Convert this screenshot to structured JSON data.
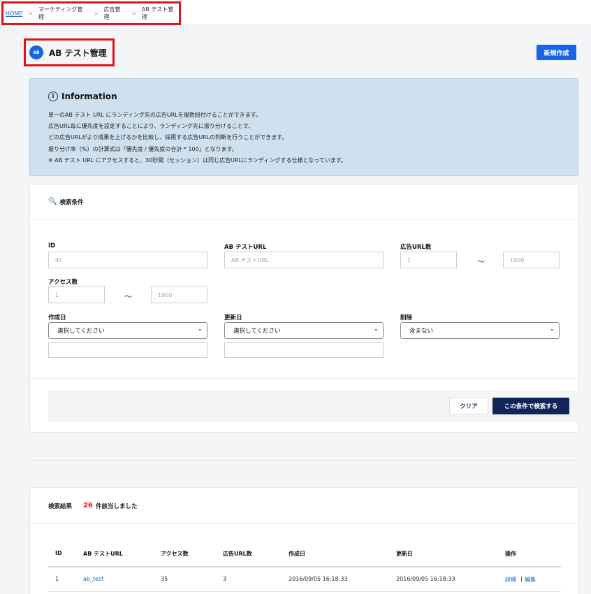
{
  "breadcrumb": {
    "items": [
      "HOME",
      "マーケティング管理",
      "広告管理",
      "AB テスト管理"
    ],
    "separator": ">"
  },
  "page": {
    "title": "AB テスト管理",
    "icon_text": "AB",
    "new_button": "新規作成"
  },
  "info": {
    "title": "Information",
    "lines": [
      "単一のAB テスト URL にランディング先の広告URLを複数紐付けることができます。",
      "広告URL毎に優先度を設定することにより、ランディング先に振り分けることで、",
      "どの広告URLがより成果を上げるかを比較し、採用する広告URLの判断を行うことができます。",
      "振り分け率（%）の計算式は「優先度 / 優先度の合計 * 100」となります。",
      "※ AB テスト URL にアクセスすると、30秒間（セッション）は同じ広告URLにランディングする仕様となっています。"
    ]
  },
  "search": {
    "heading": "検索条件",
    "id_label": "ID",
    "id_placeholder": "ID",
    "ab_url_label": "AB テストURL",
    "ab_url_placeholder": "AB テストURL",
    "ad_url_count_label": "広告URL数",
    "ad_url_min_placeholder": "1",
    "ad_url_max_placeholder": "1000",
    "access_label": "アクセス数",
    "access_min_placeholder": "1",
    "access_max_placeholder": "1000",
    "range_sep": "〜",
    "created_label": "作成日",
    "created_select": "選択してください",
    "updated_label": "更新日",
    "updated_select": "選択してください",
    "deleted_label": "削除",
    "deleted_select": "含まない",
    "clear_button": "クリア",
    "search_button": "この条件で検索する"
  },
  "results": {
    "heading": "検索結果",
    "count": "26",
    "count_suffix": "件該当しました",
    "columns": [
      "ID",
      "AB テストURL",
      "アクセス数",
      "広告URL数",
      "作成日",
      "更新日",
      "操作"
    ],
    "rows": [
      {
        "id": "1",
        "ab_url": "ab_test",
        "access": "35",
        "ad_url_count": "3",
        "created": "2016/09/05 16:18:33",
        "updated": "2016/09/05 16:18:33",
        "detail": "詳細",
        "ops_sep": "|",
        "edit": "編集"
      }
    ]
  },
  "colors": {
    "accent": "#1565e5",
    "dark_button": "#12255a",
    "highlight_border": "#e0121a",
    "info_bg": "#cfe1ee"
  }
}
